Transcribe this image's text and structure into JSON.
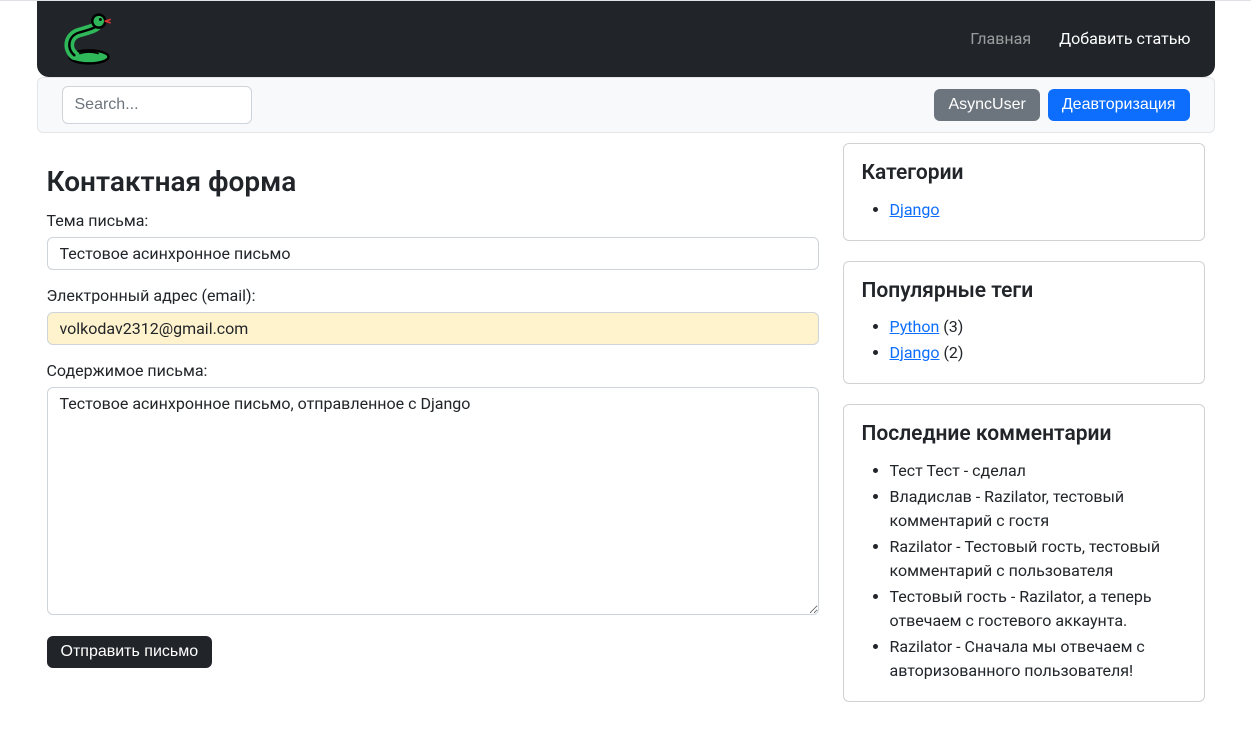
{
  "nav": {
    "home": "Главная",
    "add_article": "Добавить статью"
  },
  "subbar": {
    "search_placeholder": "Search...",
    "username": "AsyncUser",
    "logout": "Деавторизация"
  },
  "form": {
    "title": "Контактная форма",
    "subject_label": "Тема письма:",
    "subject_value": "Тестовое асинхронное письмо",
    "email_label": "Электронный адрес (email):",
    "email_value": "volkodav2312@gmail.com",
    "content_label": "Содержимое письма:",
    "content_value": "Тестовое асинхронное письмо, отправленное с Django",
    "submit": "Отправить письмо"
  },
  "sidebar": {
    "categories": {
      "title": "Категории",
      "items": [
        {
          "name": "Django"
        }
      ]
    },
    "tags": {
      "title": "Популярные теги",
      "items": [
        {
          "name": "Python",
          "count": "(3)"
        },
        {
          "name": "Django",
          "count": "(2)"
        }
      ]
    },
    "comments": {
      "title": "Последние комментарии",
      "items": [
        "Тест Тест - сделал",
        "Владислав - Razilator, тестовый комментарий с гостя",
        "Razilator - Тестовый гость, тестовый комментарий с пользователя",
        "Тестовый гость - Razilator, а теперь отвечаем с гостевого аккаунта.",
        "Razilator - Сначала мы отвечаем с авторизованного пользователя!"
      ]
    }
  }
}
